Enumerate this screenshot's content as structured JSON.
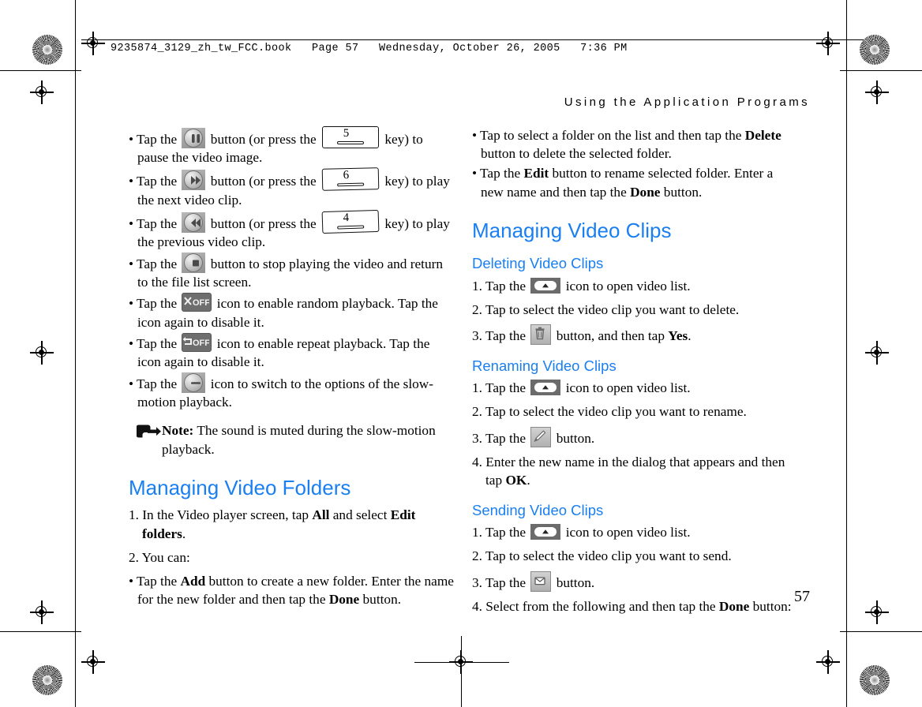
{
  "page": {
    "book_slug": "9235874_3129_zh_tw_FCC.book   Page 57   Wednesday, October 26, 2005   7:36 PM",
    "running_head": "Using the Application Programs",
    "folio": "57"
  },
  "left_column": {
    "bullets": [
      {
        "id": "pause",
        "icon": "pause-button-icon",
        "key": "5",
        "part1": "• Tap the ",
        "part2": " button (or press the ",
        "part3": " key) to pause the video image."
      },
      {
        "id": "next",
        "icon": "next-clip-button-icon",
        "key": "6",
        "part1": "• Tap the ",
        "part2": " button (or press the ",
        "part3": " key) to play the next video clip."
      },
      {
        "id": "previous",
        "icon": "previous-clip-button-icon",
        "key": "4",
        "part1": "• Tap the ",
        "part2": " button (or press the ",
        "part3": " key) to play the previous video clip."
      },
      {
        "id": "stop",
        "icon": "stop-button-icon",
        "part1": "• Tap the ",
        "part3": " button to stop playing the video and return to the file list screen."
      },
      {
        "id": "random",
        "icon": "shuffle-off-icon",
        "part1": "• Tap the ",
        "part3": " icon to enable random playback. Tap the icon again to disable it."
      },
      {
        "id": "repeat",
        "icon": "repeat-off-icon",
        "part1": "• Tap the ",
        "part3": " icon to enable repeat playback. Tap the icon again to disable it."
      },
      {
        "id": "slow-motion",
        "icon": "slow-motion-button-icon",
        "part1": "• Tap the ",
        "part3": " icon to switch to the options of the slow-motion playback."
      }
    ],
    "note": {
      "icon": "note-arrow-icon",
      "label": "Note:",
      "text": " The sound is muted during the slow-motion playback."
    },
    "section": {
      "heading": "Managing Video Folders",
      "step1_a": "1. In the Video player screen, tap ",
      "step1_b": "All",
      "step1_c": " and select ",
      "step1_d": "Edit folders",
      "step1_e": ".",
      "step2": "2. You can:",
      "add_a": "• Tap the ",
      "add_b": "Add",
      "add_c": " button to create a new folder. Enter the name for the new folder and then tap the ",
      "add_d": "Done",
      "add_e": " button."
    }
  },
  "right_column": {
    "folder_bullets": {
      "delete_a": "• Tap to select a folder on the list and then tap the ",
      "delete_b": "Delete",
      "delete_c": " button to delete the selected folder.",
      "edit_a": "• Tap the ",
      "edit_b": "Edit",
      "edit_c": " button to rename selected folder. Enter a new name and then tap the ",
      "edit_d": "Done",
      "edit_e": " button."
    },
    "section_heading": "Managing Video Clips",
    "deleting": {
      "heading": "Deleting Video Clips",
      "step1_a": "1. Tap the ",
      "step1_icon": "open-video-list-icon",
      "step1_b": " icon to open video list.",
      "step2": "2. Tap to select the video clip you want to delete.",
      "step3_a": "3. Tap the ",
      "step3_icon": "trash-icon",
      "step3_b": " button, and then tap ",
      "step3_c": "Yes",
      "step3_d": "."
    },
    "renaming": {
      "heading": "Renaming Video Clips",
      "step1_a": "1. Tap the ",
      "step1_icon": "open-video-list-icon",
      "step1_b": " icon to open video list.",
      "step2": "2. Tap to select the video clip you want to rename.",
      "step3_a": "3. Tap the ",
      "step3_icon": "pencil-icon",
      "step3_b": " button.",
      "step4_a": "4. Enter the new name in the dialog that appears and then tap ",
      "step4_b": "OK",
      "step4_c": "."
    },
    "sending": {
      "heading": "Sending Video Clips",
      "step1_a": "1. Tap the ",
      "step1_icon": "open-video-list-icon",
      "step1_b": " icon to open video list.",
      "step2": "2. Tap to select the video clip you want to send.",
      "step3_a": "3. Tap the ",
      "step3_icon": "envelope-icon",
      "step3_b": " button.",
      "step4_a": "4. Select from the following and then tap the ",
      "step4_b": "Done",
      "step4_c": " button:"
    }
  },
  "colors": {
    "heading_blue": "#1a7ff0",
    "body_text": "#000000",
    "paper": "#ffffff"
  }
}
